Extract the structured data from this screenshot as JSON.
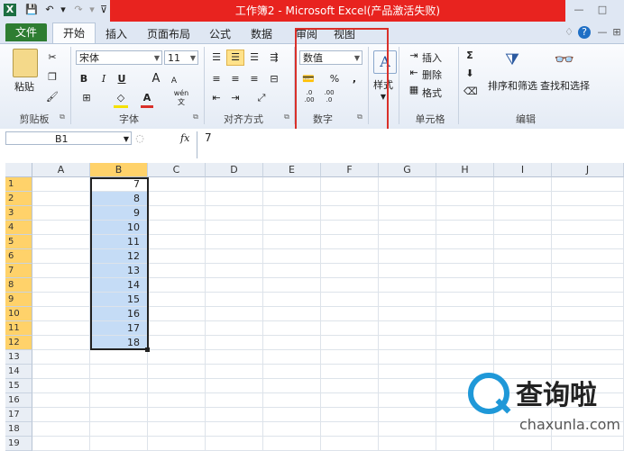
{
  "app": {
    "title": "工作簿2 - Microsoft Excel(产品激活失败)",
    "quick_access": [
      "X",
      "💾",
      "↶",
      "▾",
      "↷",
      "▾",
      "⊽"
    ],
    "window_controls": [
      "—",
      "□"
    ]
  },
  "tabs": {
    "file": "文件",
    "items": [
      "开始",
      "插入",
      "页面布局",
      "公式",
      "数据",
      "审阅",
      "视图"
    ],
    "active": "开始",
    "right_icons": [
      "♢",
      "?",
      "—",
      "⊞",
      "✕"
    ]
  },
  "ribbon": {
    "clipboard": {
      "paste": "粘贴",
      "label": "剪贴板"
    },
    "font": {
      "name": "宋体",
      "size": "11",
      "label": "字体",
      "bold": "B",
      "italic": "I",
      "underline": "U",
      "grow": "A",
      "shrink": "A",
      "font_color": "A",
      "fill_color": "◇",
      "wen": "wén"
    },
    "alignment": {
      "label": "对齐方式"
    },
    "number": {
      "format": "数值",
      "label": "数字",
      "percent": "%",
      "comma": ",",
      "inc_dec": ".0 .00",
      "dec_dec": ".00 .0"
    },
    "styles": {
      "label": "样式",
      "icon": "A"
    },
    "cells": {
      "insert": "插入",
      "delete": "删除",
      "format": "格式",
      "label": "单元格"
    },
    "editing": {
      "sum": "Σ",
      "sort_filter": "排序和筛选",
      "find_select": "查找和选择",
      "label": "编辑"
    }
  },
  "formula_bar": {
    "name_box": "B1",
    "fx": "fx",
    "value": "7"
  },
  "grid": {
    "columns": [
      "A",
      "B",
      "C",
      "D",
      "E",
      "F",
      "G",
      "H",
      "I",
      "J"
    ],
    "rows": [
      "1",
      "2",
      "3",
      "4",
      "5",
      "6",
      "7",
      "8",
      "9",
      "10",
      "11",
      "12",
      "13",
      "14",
      "15",
      "16",
      "17",
      "18",
      "19"
    ],
    "b_values": [
      "7",
      "8",
      "9",
      "10",
      "11",
      "12",
      "13",
      "14",
      "15",
      "16",
      "17",
      "18"
    ]
  },
  "watermark": {
    "brand": "查询啦",
    "domain": "chaxunla.com",
    "color": "#1f98d8"
  }
}
